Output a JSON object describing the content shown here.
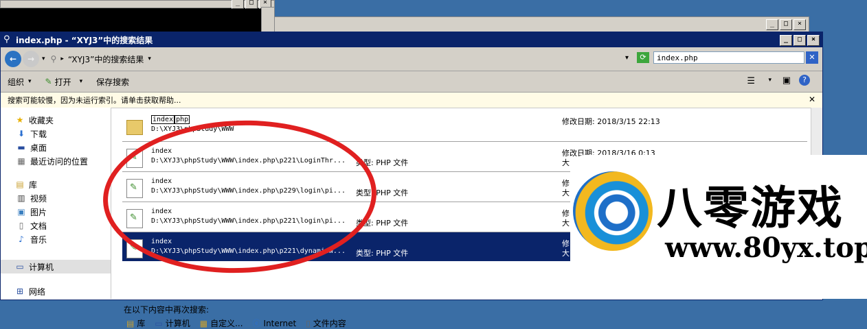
{
  "window": {
    "title": "index.php - “XYJ3”中的搜索结果",
    "controls": [
      "_",
      "□",
      "×"
    ]
  },
  "address": {
    "breadcrumb": "“XYJ3”中的搜索结果",
    "search_value": "index.php"
  },
  "toolbar": {
    "organize": "组织",
    "open": "打开",
    "save_search": "保存搜索"
  },
  "infobar": {
    "text": "搜索可能较慢，因为未运行索引。请单击获取帮助..."
  },
  "sidebar": {
    "favorites": "收藏夹",
    "favorites_items": [
      "下载",
      "桌面",
      "最近访问的位置"
    ],
    "library": "库",
    "library_items": [
      "视频",
      "图片",
      "文档",
      "音乐"
    ],
    "computer": "计算机",
    "network": "网络"
  },
  "results": [
    {
      "name_a": "index",
      "name_b": "php",
      "path": "D:\\XYJ3\\phpStudy\\WWW",
      "type": "",
      "date": "修改日期: 2018/3/15 22:13",
      "size": ""
    },
    {
      "name": "index",
      "path": "D:\\XYJ3\\phpStudy\\WWW\\index.php\\p221\\LoginThr...",
      "type": "类型: PHP 文件",
      "date": "修改日期: 2018/3/16 0:13",
      "size": "大"
    },
    {
      "name": "index",
      "path": "D:\\XYJ3\\phpStudy\\WWW\\index.php\\p229\\login\\pi...",
      "type": "类型: PHP 文件",
      "date": "修",
      "size": "大"
    },
    {
      "name": "index",
      "path": "D:\\XYJ3\\phpStudy\\WWW\\index.php\\p221\\login\\pi...",
      "type": "类型: PHP 文件",
      "date": "修",
      "size": "大"
    },
    {
      "name": "index",
      "path": "D:\\XYJ3\\phpStudy\\WWW\\index.php\\p221\\dynamicW...",
      "type": "类型: PHP 文件",
      "date": "修",
      "size": "大"
    }
  ],
  "search_again": {
    "label": "在以下内容中再次搜索:",
    "options": [
      "库",
      "计算机",
      "自定义...",
      "Internet",
      "文件内容"
    ]
  },
  "watermark": {
    "brand": "八零游戏",
    "url": "www.80yx.top"
  },
  "colors": {
    "titlebar": "#0a246a",
    "selection": "#0a246a",
    "annotation": "#e02020"
  }
}
